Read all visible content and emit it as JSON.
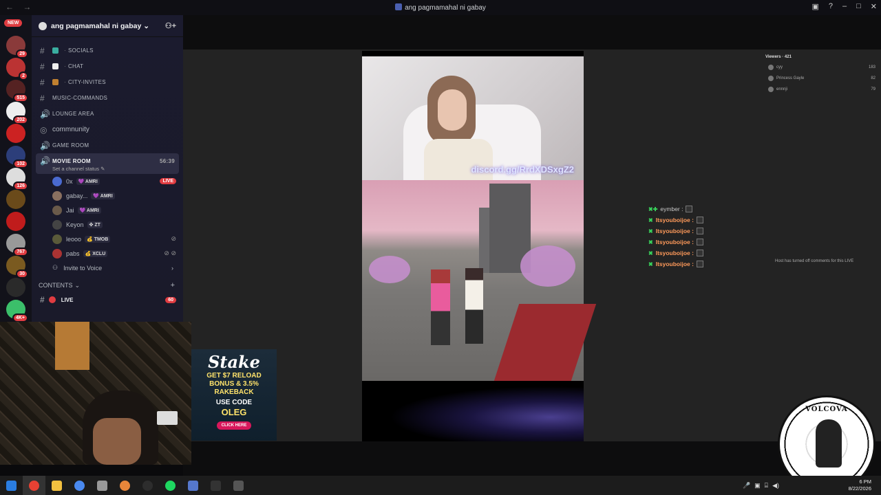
{
  "window": {
    "title": "ang pagmamahal ni gabay",
    "nav_back": "←",
    "nav_fwd": "→"
  },
  "guilds": {
    "new_label": "NEW",
    "items": [
      {
        "badge": "29",
        "color": "#8a3a3a"
      },
      {
        "badge": "2",
        "color": "#b33"
      },
      {
        "badge": "515",
        "color": "#552222"
      },
      {
        "badge": "202",
        "color": "#eee"
      },
      {
        "badge": "",
        "color": "#c22"
      },
      {
        "badge": "102",
        "color": "#2c3e7a"
      },
      {
        "badge": "126",
        "color": "#ddd"
      },
      {
        "badge": "",
        "color": "#6a4a1a"
      },
      {
        "badge": "",
        "color": "#c01c1c"
      },
      {
        "badge": "767",
        "color": "#999"
      },
      {
        "badge": "30",
        "color": "#7a5a20"
      },
      {
        "badge": "",
        "color": "#2a2a2a"
      },
      {
        "badge": "4K+",
        "color": "#3bbf6a"
      }
    ]
  },
  "server": {
    "name": "ang pagmamahal ni gabay"
  },
  "channels": [
    {
      "name": "socials",
      "type": "text",
      "emoji_color": "#3aaea0"
    },
    {
      "name": "chat",
      "type": "text",
      "emoji_color": "#eeeeee"
    },
    {
      "name": "city-invites",
      "type": "text",
      "emoji_color": "#c08030"
    },
    {
      "name": "music-commands",
      "type": "text"
    },
    {
      "name": "lounge area",
      "type": "voice"
    },
    {
      "name": "commnunity",
      "type": "forum"
    },
    {
      "name": "game room",
      "type": "voice"
    }
  ],
  "active_channel": {
    "name": "MOVIE ROOM",
    "timer": "56:39",
    "status": "Set a channel status"
  },
  "voice_users": [
    {
      "name": "0x",
      "tag": "💜 AMRI",
      "live": "LIVE",
      "color": "#4a6ad0"
    },
    {
      "name": "gabay...",
      "tag": "💜 AMRI",
      "color": "#8a7060"
    },
    {
      "name": "Jai",
      "tag": "💜 AMRI",
      "color": "#6a5a4a"
    },
    {
      "name": "Keyon",
      "tag": "✜ ZT",
      "color": "#444"
    },
    {
      "name": "leooo",
      "tag": "💰 TMOB",
      "muted": "⊘",
      "color": "#5a5a3a"
    },
    {
      "name": "pabs",
      "tag": "💰 XCLU",
      "muted": "⊘ ⊘",
      "color": "#aa3333"
    }
  ],
  "invite": {
    "label": "Invite to Voice",
    "chevron": "›"
  },
  "category": {
    "label": "CONTENTS",
    "plus": "+"
  },
  "live_channel": {
    "name": "LIVE",
    "count": "60"
  },
  "stream": {
    "discord_link": "discord.gg/RrdXDSxgZ2"
  },
  "viewers": {
    "header": "Viewers · 421",
    "list": [
      {
        "name": "cyy",
        "count": "183"
      },
      {
        "name": "Princess Gayle",
        "count": "82"
      },
      {
        "name": "ennnji",
        "count": "79"
      }
    ]
  },
  "comments": [
    {
      "user": "eymber :",
      "first": true
    },
    {
      "user": "Itsyouboijoe :"
    },
    {
      "user": "Itsyouboijoe :"
    },
    {
      "user": "Itsyouboijoe :"
    },
    {
      "user": "Itsyouboijoe :"
    },
    {
      "user": "Itsyouboijoe :"
    }
  ],
  "host_notice": "Host has turned off comments for this LIVE",
  "ad": {
    "logo": "Stake",
    "line1": "GET $7 RELOAD",
    "line2": "BONUS & 3.5%",
    "line3": "RAKEBACK",
    "line4": "USE CODE",
    "code": "OLEG",
    "button": "CLICK HERE"
  },
  "watermark": {
    "text": "VOLCOVA"
  },
  "clock": {
    "time": "6 PM",
    "date": "8/22/2026"
  },
  "taskbar": {
    "apps": [
      {
        "name": "start-menu",
        "color": "#2a7de1"
      },
      {
        "name": "chrome",
        "color": "#e84133"
      },
      {
        "name": "file-explorer",
        "color": "#f3c140"
      },
      {
        "name": "chrome-profile",
        "color": "#4a8af0"
      },
      {
        "name": "notes",
        "color": "#999999"
      },
      {
        "name": "browser-orange",
        "color": "#e8863a"
      },
      {
        "name": "obs",
        "color": "#2d2d2d"
      },
      {
        "name": "spotify",
        "color": "#1ed760"
      },
      {
        "name": "app-blue",
        "color": "#5577cc"
      },
      {
        "name": "app-dark",
        "color": "#333333"
      },
      {
        "name": "app-nvidia",
        "color": "#555555"
      }
    ]
  }
}
